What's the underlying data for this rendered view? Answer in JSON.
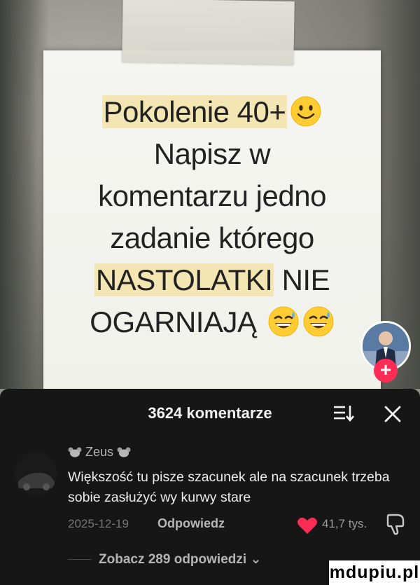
{
  "post": {
    "lines": [
      {
        "text": "Pokolenie 40+",
        "highlight": true
      },
      {
        "text": "Napisz w",
        "highlight": false
      },
      {
        "text": "komentarzu jedno",
        "highlight": false
      },
      {
        "text": "zadanie którego",
        "highlight": false
      },
      {
        "text": "NASTOLATKI",
        "highlight": true
      },
      {
        "text": "NIE",
        "highlight": false
      },
      {
        "text": "OGARNIAJĄ",
        "highlight": false
      }
    ],
    "line1_emoji": "smiling-face-icon",
    "line6_emojis": [
      "sweat-smile-icon",
      "sweat-smile-icon"
    ]
  },
  "creator": {
    "follow_label": "+"
  },
  "comments_sheet": {
    "title": "3624 komentarze",
    "sort_icon": "sort-icon",
    "close_icon": "close-icon"
  },
  "comment": {
    "username": "Zeus",
    "text": "Większość tu pisze szacunek ale na szacunek trzeba sobie zasłużyć wy kurwy stare",
    "date": "2025-12-19",
    "reply_label": "Odpowiedz",
    "likes": "41,7 tys.",
    "more_replies": "Zobacz 289 odpowiedzi",
    "more_chevron": "⌄"
  },
  "watermark": "mdupiu.pl",
  "colors": {
    "sheet_bg": "#161616",
    "heart": "#fe2c55",
    "follow": "#fe2c55",
    "highlight": "#f4e6b3"
  }
}
